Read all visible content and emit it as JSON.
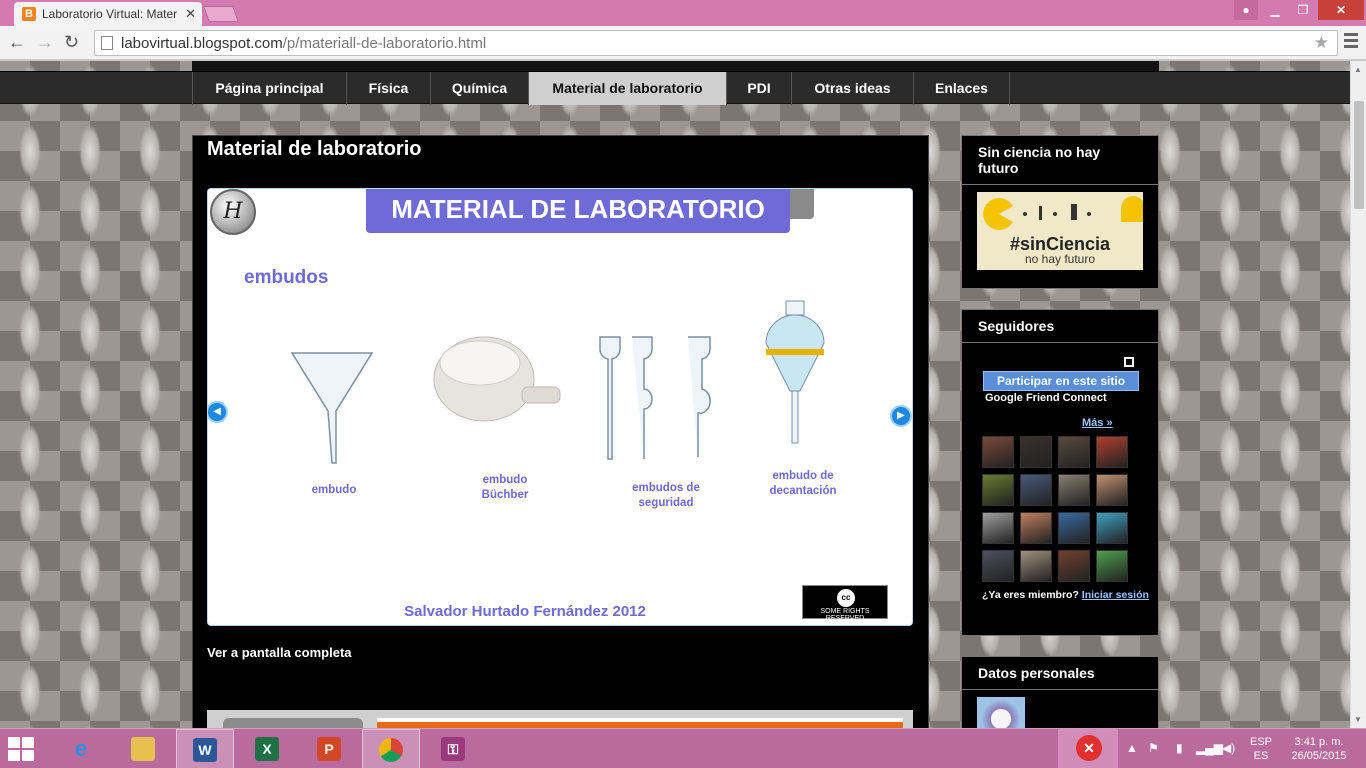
{
  "browser": {
    "tab_title": "Laboratorio Virtual: Mater",
    "tab_close": "✕",
    "url_host": "labovirtual.blogspot.com",
    "url_path": "/p/materiall-de-laboratorio.html"
  },
  "nav": {
    "items": [
      {
        "label": "Página principal",
        "active": false
      },
      {
        "label": "Física",
        "active": false
      },
      {
        "label": "Química",
        "active": false
      },
      {
        "label": "Material de laboratorio",
        "active": true
      },
      {
        "label": "PDI",
        "active": false
      },
      {
        "label": "Otras ideas",
        "active": false
      },
      {
        "label": "Enlaces",
        "active": false
      }
    ]
  },
  "post": {
    "title": "Material de laboratorio",
    "fullscreen_link": "Ver a pantalla completa"
  },
  "slide": {
    "banner": "MATERIAL DE LABORATORIO",
    "logo_text": "H",
    "subtitle": "embudos",
    "captions": [
      "embudo",
      "embudo\nBüchber",
      "embudos de\nseguridad",
      "embudo de\ndecantación"
    ],
    "author": "Salvador Hurtado Fernández 2012",
    "cc_text": "SOME RIGHTS RESERVED",
    "cc_symbol": "cc"
  },
  "sidebar": {
    "sinciencia": {
      "title": "Sin ciencia no hay futuro",
      "hashtag": "#sinCiencia",
      "subtitle": "no hay futuro"
    },
    "followers": {
      "title": "Seguidores",
      "join_button": "Participar en este sitio",
      "provider": "Google Friend Connect",
      "more_link": "Más »",
      "member_prompt": "¿Ya eres miembro?",
      "signin_link": "Iniciar sesión",
      "avatar_colors": [
        "#7a4a3a",
        "#3a3030",
        "#5a4a40",
        "#b04030",
        "#6a7a30",
        "#4a5a7a",
        "#8a8070",
        "#c09070",
        "#a0a0a0",
        "#c08060",
        "#3a6aa0",
        "#40a0c0",
        "#505060",
        "#a09080",
        "#704030",
        "#50a050"
      ]
    },
    "personal": {
      "title": "Datos personales"
    }
  },
  "taskbar": {
    "language_top": "ESP",
    "language_bottom": "ES",
    "time": "3:41 p. m.",
    "date": "26/05/2015"
  }
}
